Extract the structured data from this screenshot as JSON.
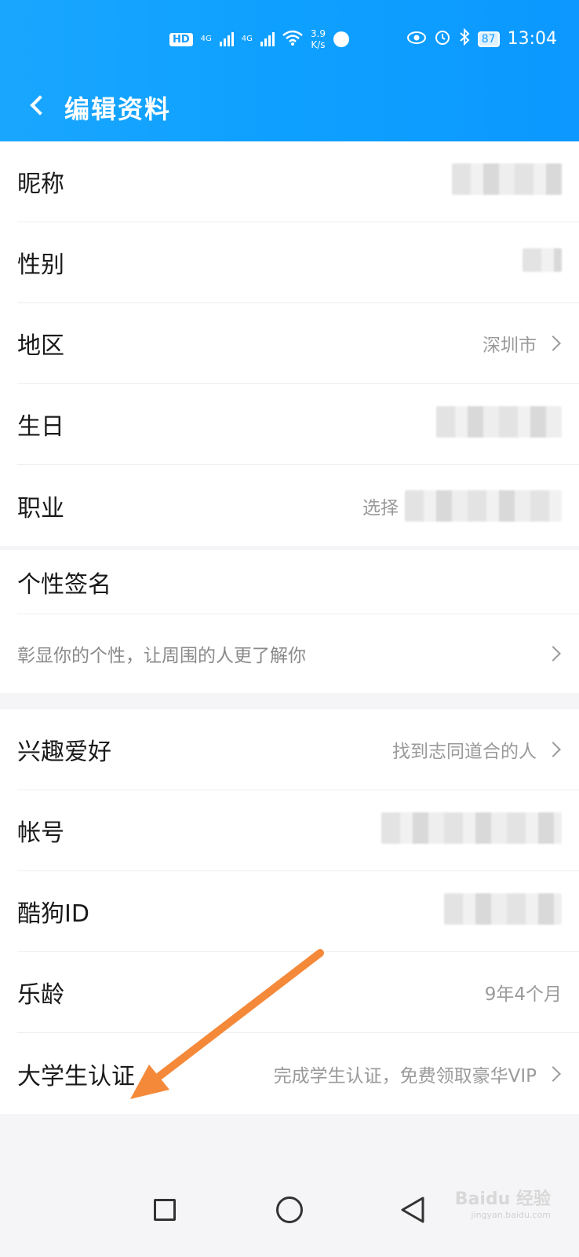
{
  "status_bar": {
    "hd": "HD",
    "net1": "4G",
    "net2": "4G",
    "speed_value": "3.9",
    "speed_unit": "K/s",
    "battery": "87",
    "time": "13:04"
  },
  "header": {
    "title": "编辑资料"
  },
  "group1": [
    {
      "label": "昵称",
      "value": ""
    },
    {
      "label": "性别",
      "value": ""
    },
    {
      "label": "地区",
      "value": "深圳市"
    },
    {
      "label": "生日",
      "value": ""
    },
    {
      "label": "职业",
      "value": "选择"
    }
  ],
  "signature": {
    "label": "个性签名",
    "placeholder": "彰显你的个性，让周围的人更了解你"
  },
  "group3": [
    {
      "label": "兴趣爱好",
      "value": "找到志同道合的人"
    },
    {
      "label": "帐号",
      "value": ""
    },
    {
      "label": "酷狗ID",
      "value": ""
    },
    {
      "label": "乐龄",
      "value": "9年4个月"
    },
    {
      "label": "大学生认证",
      "value": "完成学生认证，免费领取豪华VIP"
    }
  ],
  "watermark": {
    "text": "Baidu 经验",
    "sub": "jingyan.baidu.com"
  },
  "colors": {
    "header": "#139bff",
    "annotation_arrow": "#f5893a"
  }
}
